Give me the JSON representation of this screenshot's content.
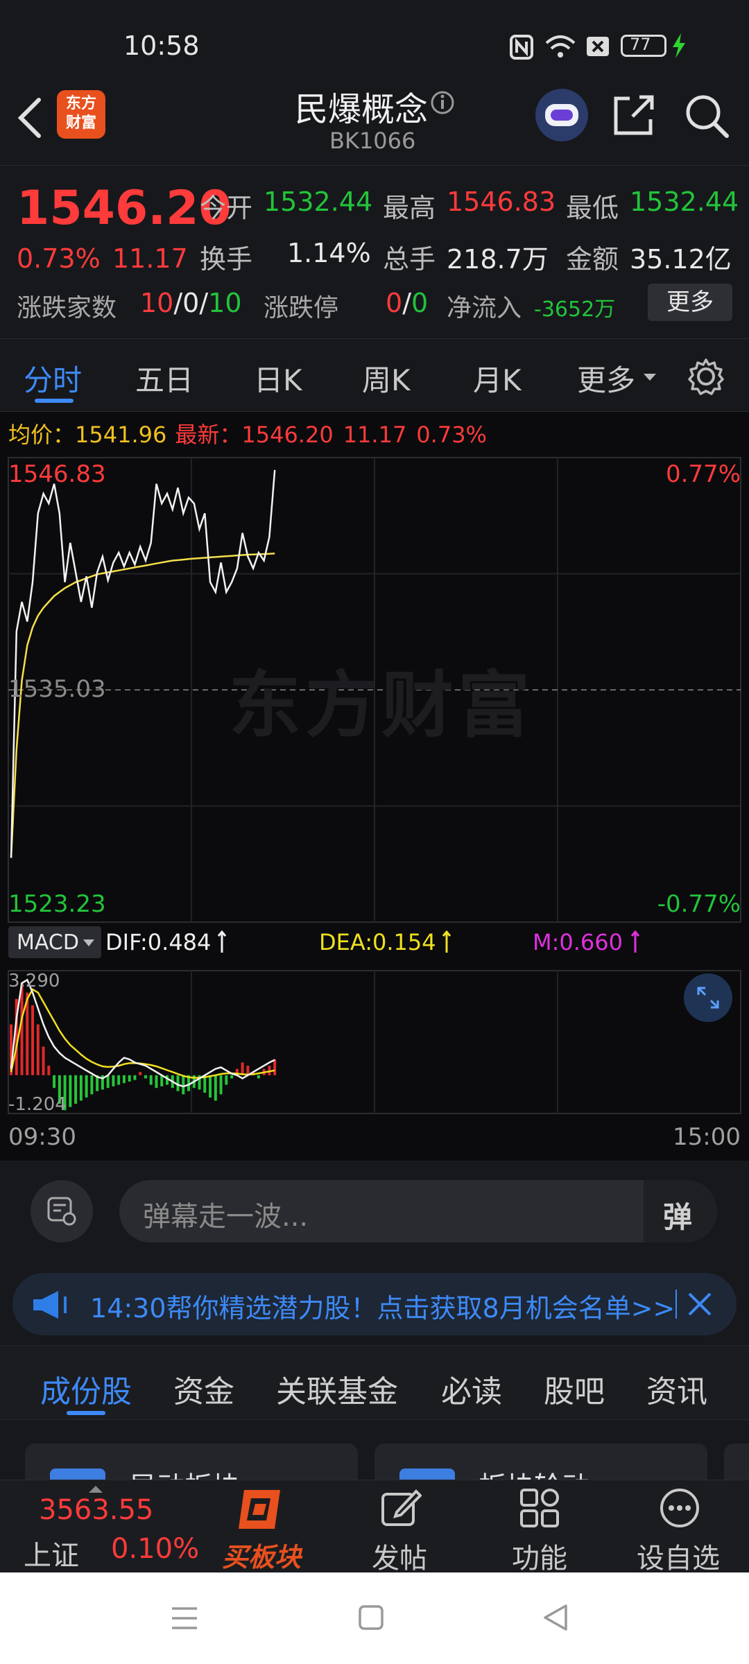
{
  "status_bar": {
    "time": "10:58",
    "battery": "77"
  },
  "header": {
    "logo_text": "东方\n财富",
    "title": "民爆概念",
    "code": "BK1066"
  },
  "quote": {
    "price": "1546.20",
    "change_pct": "0.73%",
    "change": "11.17",
    "open_label": "今开",
    "open": "1532.44",
    "high_label": "最高",
    "high": "1546.83",
    "low_label": "最低",
    "low": "1532.44",
    "turnover_label": "换手",
    "turnover": "1.14%",
    "volume_label": "总手",
    "volume": "218.7万",
    "amount_label": "金额",
    "amount": "35.12亿",
    "updown_label": "涨跌家数",
    "up": "10",
    "sep1": "/",
    "flat": "0",
    "sep2": "/",
    "down": "10",
    "limit_label": "涨跌停",
    "limit_up": "0",
    "limit_sep": "/",
    "limit_down": "0",
    "netflow_label": "净流入",
    "netflow": "-3652万",
    "more_button": "更多"
  },
  "tabs": [
    "分时",
    "五日",
    "日K",
    "周K",
    "月K",
    "更多"
  ],
  "active_tab": 0,
  "chart_info": {
    "avg_label": "均价：",
    "avg": "1541.96",
    "latest_label": "最新：",
    "latest": "1546.20",
    "latest_change": "11.17",
    "latest_pct": "0.73%"
  },
  "chart_data": {
    "type": "line",
    "y_top": "1546.83",
    "y_mid": "1535.03",
    "y_bottom": "1523.23",
    "pct_top": "0.77%",
    "pct_bottom": "-0.77%",
    "ylim": [
      1523.23,
      1546.83
    ],
    "watermark": "东方财富",
    "price_series": [
      1526.5,
      1538,
      1539.5,
      1538.5,
      1540.5,
      1544,
      1545,
      1544.5,
      1545.5,
      1544,
      1540.5,
      1542.5,
      1541,
      1539.5,
      1540.8,
      1539.2,
      1541,
      1541.8,
      1540.6,
      1541.5,
      1542,
      1541.3,
      1542,
      1541.4,
      1542.3,
      1541.6,
      1542.5,
      1545.5,
      1544.5,
      1545,
      1544.2,
      1545.3,
      1544,
      1544.8,
      1544.5,
      1543.2,
      1544,
      1540.5,
      1540,
      1541.5,
      1540,
      1540.5,
      1541.2,
      1543,
      1541.8,
      1541.2,
      1542,
      1541.6,
      1542.8,
      1546.2
    ],
    "avg_series": [
      1526.5,
      1532,
      1535.5,
      1537.3,
      1538.2,
      1538.8,
      1539.2,
      1539.5,
      1539.8,
      1540,
      1540.2,
      1540.35,
      1540.5,
      1540.6,
      1540.7,
      1540.8,
      1540.9,
      1540.95,
      1541,
      1541.05,
      1541.1,
      1541.15,
      1541.2,
      1541.25,
      1541.3,
      1541.35,
      1541.4,
      1541.45,
      1541.5,
      1541.55,
      1541.6,
      1541.62,
      1541.65,
      1541.68,
      1541.7,
      1541.72,
      1541.74,
      1541.76,
      1541.78,
      1541.8,
      1541.82,
      1541.84,
      1541.86,
      1541.88,
      1541.9,
      1541.91,
      1541.92,
      1541.93,
      1541.94,
      1541.96
    ],
    "x_start": "09:30",
    "x_end": "15:00"
  },
  "macd": {
    "label": "MACD",
    "dif_label": "DIF:0.484",
    "dea_label": "DEA:0.154",
    "m_label": "M:0.660",
    "y_top": "3.290",
    "y_bottom": "-1.204",
    "hist": [
      1.6,
      2.4,
      2.9,
      2.6,
      2.2,
      1.6,
      0.9,
      0.3,
      -0.4,
      -0.9,
      -1.1,
      -1.0,
      -0.9,
      -0.8,
      -0.7,
      -0.6,
      -0.5,
      -0.45,
      -0.4,
      -0.35,
      -0.3,
      -0.25,
      -0.2,
      -0.15,
      0.1,
      -0.1,
      -0.3,
      -0.4,
      -0.35,
      -0.3,
      -0.4,
      -0.5,
      -0.6,
      -0.5,
      -0.4,
      -0.45,
      -0.55,
      -0.7,
      -0.8,
      -0.6,
      -0.3,
      -0.1,
      0.2,
      0.4,
      0.3,
      0.1,
      -0.1,
      0.2,
      0.3,
      0.5
    ],
    "dif": [
      0.2,
      1.8,
      2.9,
      3.0,
      2.6,
      2.1,
      1.6,
      1.2,
      0.9,
      0.7,
      0.55,
      0.45,
      0.35,
      0.25,
      0.15,
      0.05,
      -0.05,
      -0.1,
      0.0,
      0.2,
      0.4,
      0.55,
      0.5,
      0.4,
      0.35,
      0.3,
      0.2,
      0.1,
      0.0,
      -0.1,
      -0.2,
      -0.3,
      -0.35,
      -0.3,
      -0.2,
      -0.1,
      0.0,
      0.1,
      0.2,
      0.25,
      0.15,
      0.05,
      0.0,
      -0.1,
      0.0,
      0.1,
      0.2,
      0.3,
      0.4,
      0.484
    ],
    "dea": [
      0.1,
      0.9,
      1.8,
      2.4,
      2.7,
      2.6,
      2.3,
      2.0,
      1.7,
      1.4,
      1.15,
      0.95,
      0.8,
      0.65,
      0.52,
      0.42,
      0.34,
      0.28,
      0.26,
      0.27,
      0.3,
      0.35,
      0.38,
      0.38,
      0.37,
      0.35,
      0.32,
      0.28,
      0.22,
      0.16,
      0.1,
      0.04,
      -0.02,
      -0.06,
      -0.08,
      -0.08,
      -0.06,
      -0.03,
      0.0,
      0.04,
      0.06,
      0.06,
      0.05,
      0.03,
      0.02,
      0.03,
      0.06,
      0.09,
      0.12,
      0.154
    ]
  },
  "danmu": {
    "placeholder": "弹幕走一波...",
    "send_button": "弹"
  },
  "banner": {
    "text": "14:30帮你精选潜力股！点击获取8月机会名单>>"
  },
  "subtabs": [
    "成份股",
    "资金",
    "关联基金",
    "必读",
    "股吧",
    "资讯"
  ],
  "cards": [
    "异动板块",
    "板块轮动"
  ],
  "bottom": {
    "index_value": "3563.55",
    "index_name": "上证",
    "index_pct": "0.10%",
    "buy_label": "买板块",
    "post_label": "发帖",
    "func_label": "功能",
    "watch_label": "设自选"
  }
}
